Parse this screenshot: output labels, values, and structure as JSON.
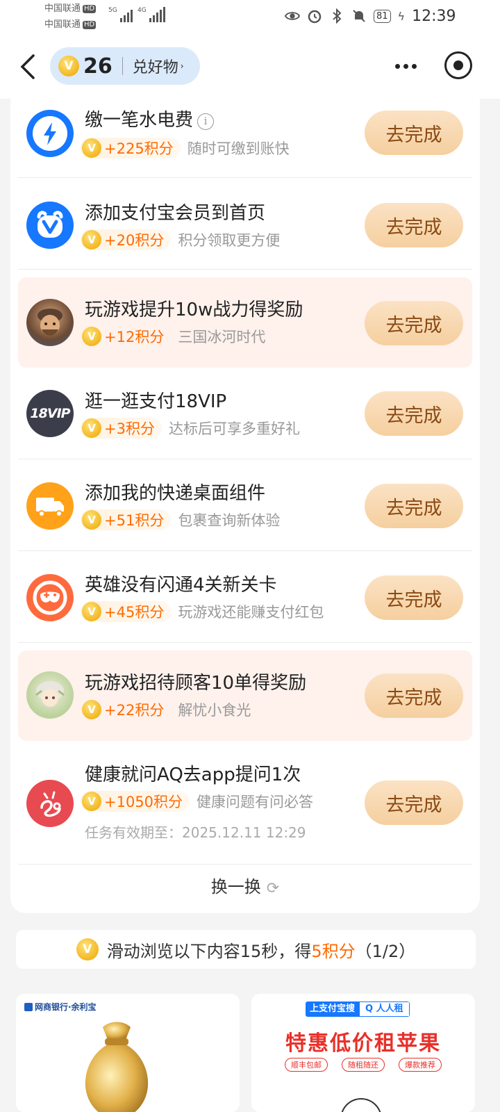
{
  "status_bar": {
    "carrier1": "中国联通",
    "carrier2": "中国联通",
    "hd": "HD",
    "net1": "5G",
    "net2": "4G",
    "battery": "81",
    "time": "12:39"
  },
  "nav": {
    "points": "26",
    "exchange_label": "兑好物",
    "exchange_arrow": "›"
  },
  "coin_glyph": "V",
  "tasks": [
    {
      "title": "缴一笔水电费",
      "has_info": true,
      "reward": "+225积分",
      "desc": "随时可缴到账快",
      "button": "去完成"
    },
    {
      "title": "添加支付宝会员到首页",
      "reward": "+20积分",
      "desc": "积分领取更方便",
      "button": "去完成"
    },
    {
      "title": "玩游戏提升10w战力得奖励",
      "reward": "+12积分",
      "desc": "三国冰河时代",
      "button": "去完成"
    },
    {
      "title": "逛一逛支付18VIP",
      "reward": "+3积分",
      "desc": "达标后可享多重好礼",
      "button": "去完成",
      "icon_text": "18VIP"
    },
    {
      "title": "添加我的快递桌面组件",
      "reward": "+51积分",
      "desc": "包裹查询新体验",
      "button": "去完成"
    },
    {
      "title": "英雄没有闪通4关新关卡",
      "reward": "+45积分",
      "desc": "玩游戏还能赚支付红包",
      "button": "去完成"
    },
    {
      "title": "玩游戏招待顾客10单得奖励",
      "reward": "+22积分",
      "desc": "解忧小食光",
      "button": "去完成"
    },
    {
      "title": "健康就问AQ去app提问1次",
      "reward": "+1050积分",
      "desc": "健康问题有问必答",
      "button": "去完成",
      "expire": "任务有效期至：2025.12.11 12:29"
    }
  ],
  "info_glyph": "i",
  "refresh_label": "换一换",
  "browse": {
    "prefix": "滑动浏览以下内容15秒，得",
    "points": "5积分",
    "suffix": "（1/2）"
  },
  "ads": {
    "left": {
      "brand": "网商银行·余利宝"
    },
    "right": {
      "search_a": "上支付宝搜",
      "search_b": "Q 人人租",
      "headline": "特惠低价租苹果",
      "tags": [
        "顺丰包邮",
        "随租随还",
        "爆款推荐"
      ]
    }
  },
  "colors": {
    "accent_orange": "#ff6a00",
    "button_bg": "#f5cf9f",
    "button_text": "#8a4a13",
    "pill_bg": "#dbeafb",
    "highlight_row": "#fff1ec"
  }
}
